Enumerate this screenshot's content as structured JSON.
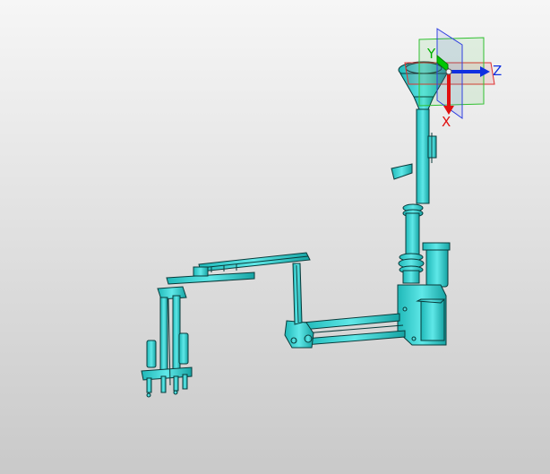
{
  "viewport": {
    "background_top": "#f6f6f6",
    "background_bottom": "#c9c9c9"
  },
  "model": {
    "fill_color": "#25d0d0",
    "edge_color": "#0a3a3a"
  },
  "triad": {
    "x_label": "X",
    "y_label": "Y",
    "z_label": "Z",
    "x_color": "#e01010",
    "y_color": "#00c800",
    "z_color": "#1030e0",
    "plane_xy_color": "#e03030",
    "plane_yz_color": "#3040e0",
    "plane_xz_color": "#30c030"
  }
}
